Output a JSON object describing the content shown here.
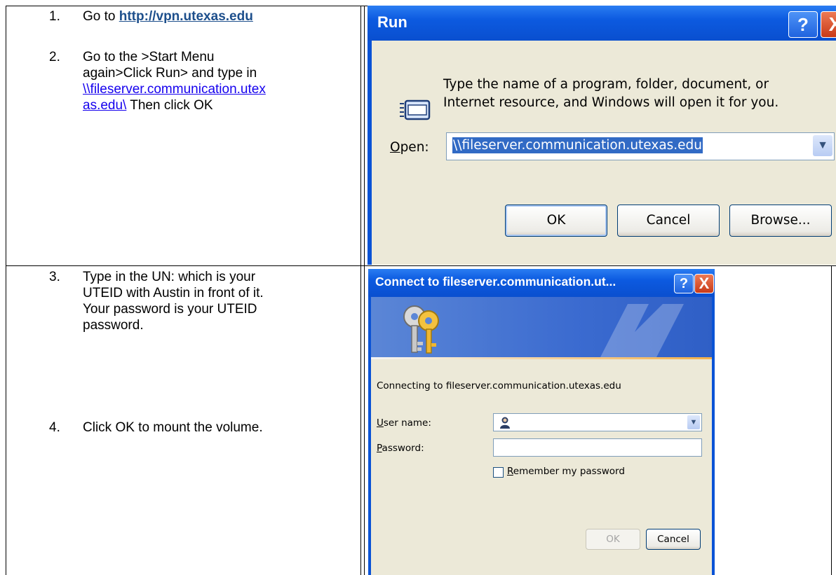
{
  "steps": [
    {
      "num": "1.",
      "pre": "Go to ",
      "link": "http://vpn.utexas.edu"
    },
    {
      "num": "2.",
      "line1": "Go to the >Start Menu",
      "line2": "again>Click Run> and type in",
      "link1": "\\\\fileserver.communication.utex",
      "link2": "as.edu\\",
      "post": " Then click OK"
    },
    {
      "num": "3.",
      "line1": "Type in the UN: which is your",
      "line2": "UTEID with Austin in front of it.",
      "line3": "Your password is your UTEID",
      "line4": "password."
    },
    {
      "num": "4.",
      "text": "Click OK to mount the volume."
    }
  ],
  "run_dialog": {
    "title": "Run",
    "help": "?",
    "close": "X",
    "prompt_line1": "Type the name of a program, folder, document, or",
    "prompt_line2": "Internet resource, and Windows will open it for you.",
    "open_label": "Open:",
    "open_value": "\\\\fileserver.communication.utexas.edu",
    "ok": "OK",
    "cancel": "Cancel",
    "browse": "Browse..."
  },
  "connect_dialog": {
    "title": "Connect to fileserver.communication.ut...",
    "help": "?",
    "close": "X",
    "connecting_text": "Connecting to fileserver.communication.utexas.edu",
    "username_label": "User name:",
    "password_label": "Password:",
    "remember_label": "Remember my password",
    "remember_checked": false,
    "ok": "OK",
    "cancel": "Cancel"
  },
  "colors": {
    "xp_blue": "#0a53d6",
    "dialog_face": "#ece9d8",
    "selection": "#316ac5",
    "link_blue": "#1500ee",
    "link_bold": "#1d4f8c"
  }
}
